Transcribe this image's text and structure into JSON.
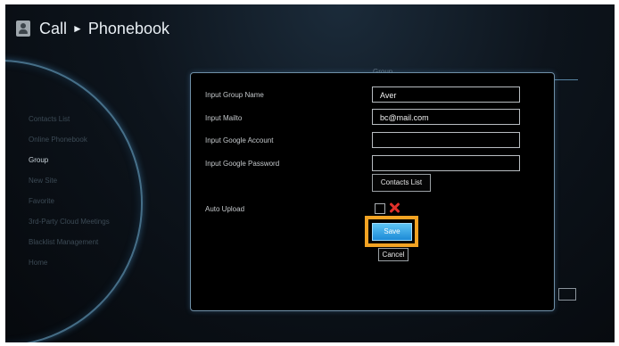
{
  "header": {
    "icon": "phonebook-icon",
    "title_primary": "Call",
    "separator": "►",
    "title_secondary": "Phonebook"
  },
  "tab_label": "Group",
  "side_menu": {
    "items": [
      {
        "label": "Contacts List"
      },
      {
        "label": "Online Phonebook"
      },
      {
        "label": "Group"
      },
      {
        "label": "New Site"
      },
      {
        "label": "Favorite"
      },
      {
        "label": "3rd-Party Cloud Meetings"
      },
      {
        "label": "Blacklist Management"
      },
      {
        "label": "Home"
      }
    ],
    "active_index": 2
  },
  "dialog": {
    "fields": [
      {
        "label": "Input Group Name",
        "value": "Aver"
      },
      {
        "label": "Input Mailto",
        "value": "bc@mail.com"
      },
      {
        "label": "Input Google Account",
        "value": ""
      },
      {
        "label": "Input Google Password",
        "value": ""
      }
    ],
    "contacts_button": "Contacts List",
    "auto_upload_label": "Auto Upload",
    "auto_upload_icon": "red-x-icon",
    "save_button": "Save",
    "cancel_button": "Cancel"
  },
  "colors": {
    "highlight": "#f3a323",
    "save_button": "#2fa3e6",
    "x_icon": "#e0302a"
  }
}
